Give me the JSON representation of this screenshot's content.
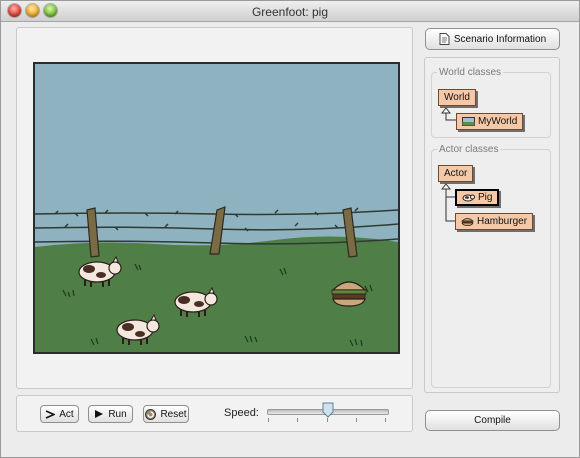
{
  "window": {
    "title": "Greenfoot: pig"
  },
  "scenario_button": {
    "label": "Scenario Information"
  },
  "classes": {
    "world_heading": "World classes",
    "world_root": "World",
    "world_sub": "MyWorld",
    "actor_heading": "Actor classes",
    "actor_root": "Actor",
    "actor_subs": [
      "Pig",
      "Hamburger"
    ]
  },
  "controls": {
    "act": "Act",
    "run": "Run",
    "reset": "Reset",
    "speed_label": "Speed:",
    "speed_value_fraction": 0.5
  },
  "compile_button": {
    "label": "Compile"
  },
  "world_scene": {
    "sky_color": "#8eb2bf",
    "grass_color": "#4f7e47",
    "pig_count": 3,
    "hamburger_count": 1
  }
}
